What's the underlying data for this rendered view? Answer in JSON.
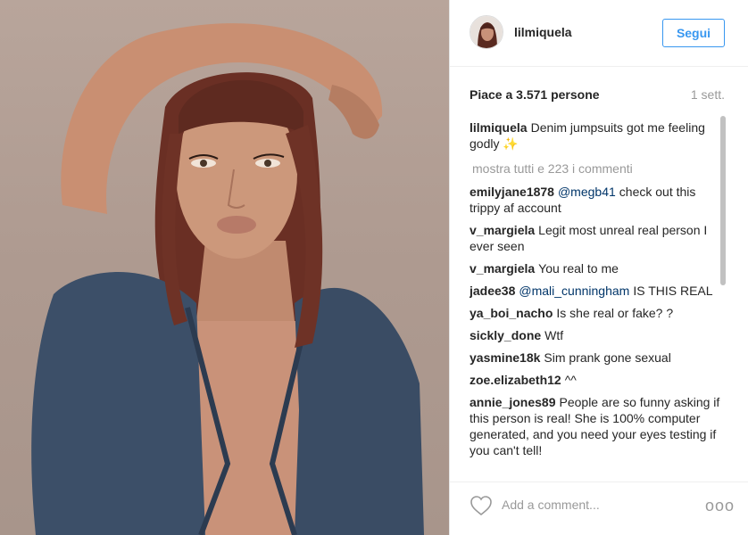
{
  "post": {
    "username": "lilmiquela",
    "follow_label": "Segui",
    "likes_text": "Piace a 3.571 persone",
    "time_ago": "1 sett.",
    "caption": {
      "author": "lilmiquela",
      "text": "Denim jumpsuits got me feeling godly",
      "emoji": "✨"
    },
    "show_all_label": "mostra tutti e 223 i commenti",
    "comments": [
      {
        "author": "emilyjane1878",
        "mention": "@megb41",
        "text": "check out this trippy af account"
      },
      {
        "author": "v_margiela",
        "mention": "",
        "text": "Legit most unreal real person I ever seen"
      },
      {
        "author": "v_margiela",
        "mention": "",
        "text": "You real to me"
      },
      {
        "author": "jadee38",
        "mention": "@mali_cunningham",
        "text": "IS THIS REAL"
      },
      {
        "author": "ya_boi_nacho",
        "mention": "",
        "text": "Is she real or fake? ?"
      },
      {
        "author": "sickly_done",
        "mention": "",
        "text": "Wtf"
      },
      {
        "author": "yasmine18k",
        "mention": "",
        "text": "Sim prank gone sexual"
      },
      {
        "author": "zoe.elizabeth12",
        "mention": "",
        "text": "^^"
      },
      {
        "author": "annie_jones89",
        "mention": "",
        "text": "People are so funny asking if this person is real! She is 100% computer generated, and you need your eyes testing if you can't tell!"
      }
    ],
    "comment_placeholder": "Add a comment...",
    "more_label": "ooo"
  },
  "icons": {
    "like": "heart-outline-icon",
    "more": "more-options-icon"
  },
  "colors": {
    "accent": "#3897f0",
    "mention": "#003569",
    "muted": "#999999",
    "photo_background": "#b3a096"
  }
}
